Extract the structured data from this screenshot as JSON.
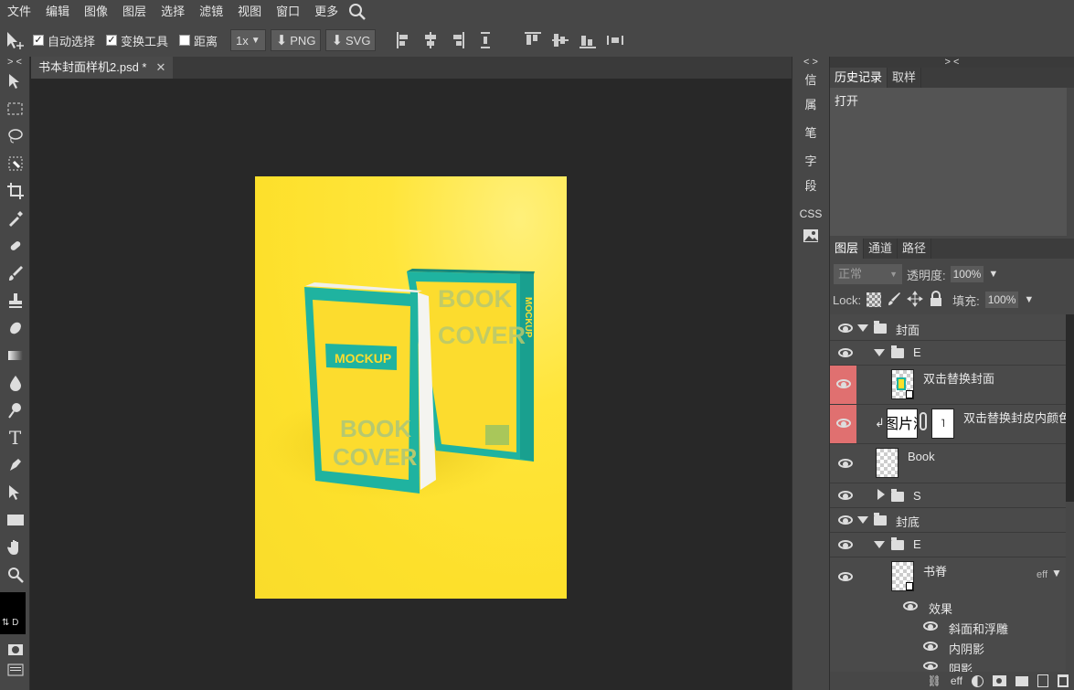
{
  "menu": [
    "文件",
    "编辑",
    "图像",
    "图层",
    "选择",
    "滤镜",
    "视图",
    "窗口",
    "更多"
  ],
  "options": {
    "auto_select": "自动选择",
    "transform_tools": "变换工具",
    "distance": "距离",
    "zoom": "1x",
    "png": "PNG",
    "svg": "SVG"
  },
  "doc_tab": {
    "title": "书本封面样机2.psd *",
    "close": "✕"
  },
  "mini_panel": [
    "信",
    "属",
    "笔",
    "字",
    "段",
    "CSS"
  ],
  "panel_toggle": "> <",
  "left_toggle": "> <",
  "mini_toggle": "< >",
  "history": {
    "tabs": [
      "历史记录",
      "取样"
    ],
    "items": [
      "打开"
    ]
  },
  "layers_panel": {
    "tabs": [
      "图层",
      "通道",
      "路径"
    ],
    "blend": "正常",
    "opacity_label": "透明度:",
    "opacity": "100%",
    "lock_label": "Lock:",
    "fill_label": "填充:",
    "fill": "100%"
  },
  "layers": {
    "r1": "封面",
    "r2": "E",
    "r3": "双击替换封面",
    "r4": "双击替换封皮内颜色",
    "r4_thumb": "图片浏",
    "r5": "Book",
    "r6": "S",
    "r7": "封底",
    "r8": "E",
    "r9": "书脊",
    "r9_eff": "eff"
  },
  "effects": {
    "title": "效果",
    "e1": "斜面和浮雕",
    "e2": "内阴影",
    "e3": "阴影"
  },
  "book": {
    "mockup": "MOCKUP",
    "book": "BOOK",
    "cover": "COVER"
  },
  "status": {
    "eff": "eff"
  },
  "colors": {
    "teal": "#1fb3a0",
    "yellow": "#fde02b",
    "highlight": "#e07070"
  }
}
